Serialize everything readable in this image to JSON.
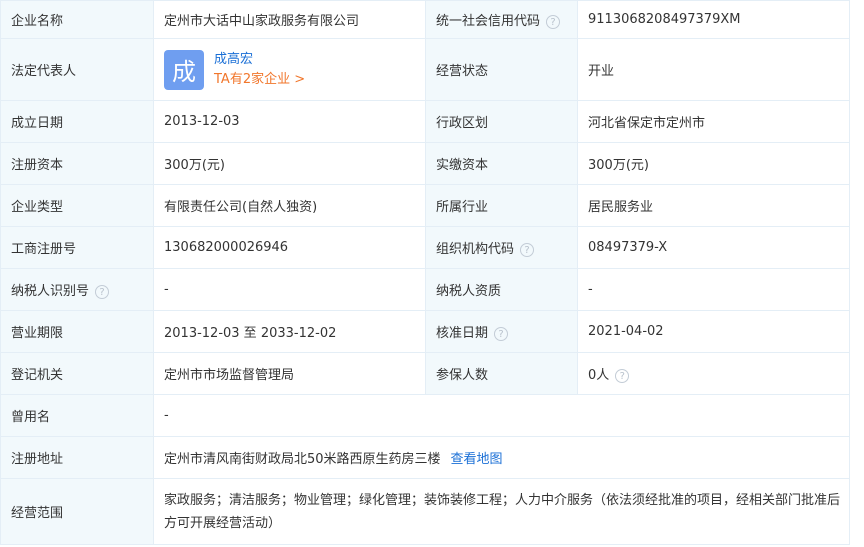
{
  "rows": {
    "r0": {
      "l1": "企业名称",
      "v1": "定州市大话中山家政服务有限公司",
      "l2": "统一社会信用代码",
      "v2": "911306820849737​9XM"
    },
    "r1": {
      "l1": "法定代表人",
      "avatar_char": "成",
      "name": "成高宏",
      "companies_link": "TA有2家企业 >",
      "l2": "经营状态",
      "v2": "开业"
    },
    "r2": {
      "l1": "成立日期",
      "v1": "2013-12-03",
      "l2": "行政区划",
      "v2": "河北省保定市定州市"
    },
    "r3": {
      "l1": "注册资本",
      "v1": "300万(元)",
      "l2": "实缴资本",
      "v2": "300万(元)"
    },
    "r4": {
      "l1": "企业类型",
      "v1": "有限责任公司(自然人独资)",
      "l2": "所属行业",
      "v2": "居民服务业"
    },
    "r5": {
      "l1": "工商注册号",
      "v1": "130682000026946",
      "l2": "组织机构代码",
      "v2": "08497379-X"
    },
    "r6": {
      "l1": "纳税人识别号",
      "v1": "-",
      "l2": "纳税人资质",
      "v2": "-"
    },
    "r7": {
      "l1": "营业期限",
      "v1": "2013-12-03 至 2033-12-02",
      "l2": "核准日期",
      "v2": "2021-04-02"
    },
    "r8": {
      "l1": "登记机关",
      "v1": "定州市市场监督管理局",
      "l2": "参保人数",
      "v2": "0人"
    },
    "r9": {
      "l1": "曾用名",
      "v1": "-"
    },
    "r10": {
      "l1": "注册地址",
      "v1": "定州市清风南街财政局北50米路西原生药房三楼",
      "map_link": "查看地图"
    },
    "r11": {
      "l1": "经营范围",
      "v1": "家政服务；清洁服务；物业管理；绿化管理；装饰装修工程；人力中介服务（依法须经批准的项目，经相关部门批准后方可开展经营活动）"
    }
  },
  "help_glyph": "?",
  "icons": {
    "help": "question-circle-icon"
  },
  "colors": {
    "label_bg": "#f2f9fc",
    "border": "#e4eef6",
    "link": "#1a6fd6",
    "accent_orange": "#f1762b",
    "avatar_bg": "#6f9ef0"
  }
}
